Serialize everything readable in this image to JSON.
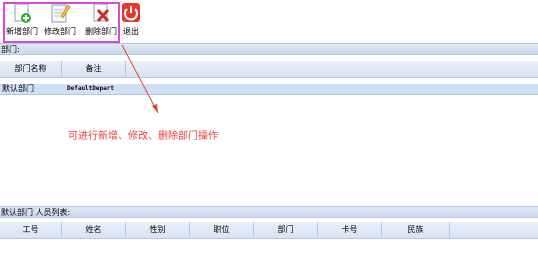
{
  "toolbar": {
    "add_label": "新增部门",
    "edit_label": "修改部门",
    "delete_label": "删除部门",
    "exit_label": "退出"
  },
  "dept_section": {
    "title": "部门:",
    "columns": [
      "部门名称",
      "备注"
    ],
    "rows": [
      {
        "name": "默认部门",
        "remark": "DefaultDepart"
      }
    ]
  },
  "annotation": {
    "text": "可进行新增、修改、删除部门操作",
    "color": "#e8413a"
  },
  "staff_section": {
    "title": "默认部门 人员列表:",
    "columns": [
      "工号",
      "姓名",
      "性别",
      "职位",
      "部门",
      "卡号",
      "民族"
    ]
  },
  "colors": {
    "highlight": "#d64ad6",
    "exit_icon": "#e23b2e",
    "header_bar": "#c8d8ee"
  }
}
